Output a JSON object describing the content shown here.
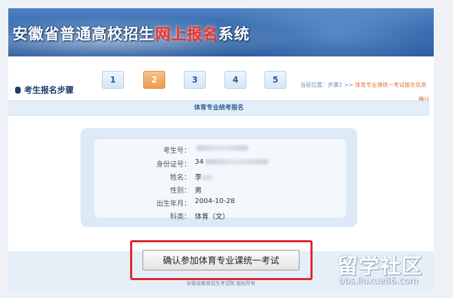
{
  "banner": {
    "title_part1": "安徽省普通高校招生",
    "title_highlight": "网上报名",
    "title_part2": "系统"
  },
  "steps": {
    "label": "考生报名步骤",
    "items": [
      "1",
      "2",
      "3",
      "4",
      "5"
    ],
    "active": "2"
  },
  "location": {
    "prefix": "当前位置：步骤2 >> ",
    "path": "体育专业课统一考试报名信息",
    "path_end": "确认"
  },
  "section": {
    "title": "体育专业统考报名"
  },
  "info": {
    "rows": [
      {
        "label": "考生号：",
        "value": ""
      },
      {
        "label": "身份证号：",
        "value": "34"
      },
      {
        "label": "姓名：",
        "value": "李"
      },
      {
        "label": "性别：",
        "value": "男"
      },
      {
        "label": "出生年月：",
        "value": "2004-10-28"
      },
      {
        "label": "科类：",
        "value": "体育（文）"
      }
    ]
  },
  "confirm_button": "确认参加体育专业课统一考试",
  "footer": "安徽省教育招生考试院 版权所有",
  "watermark": {
    "main": "留学社区",
    "url": "bbs.liuxue86.com"
  },
  "colors": {
    "banner": "#2e63a8",
    "highlight": "#e8352f",
    "active_step": "#ee9a4a",
    "panel": "#dde9f6",
    "red_outline": "#e0242b"
  }
}
